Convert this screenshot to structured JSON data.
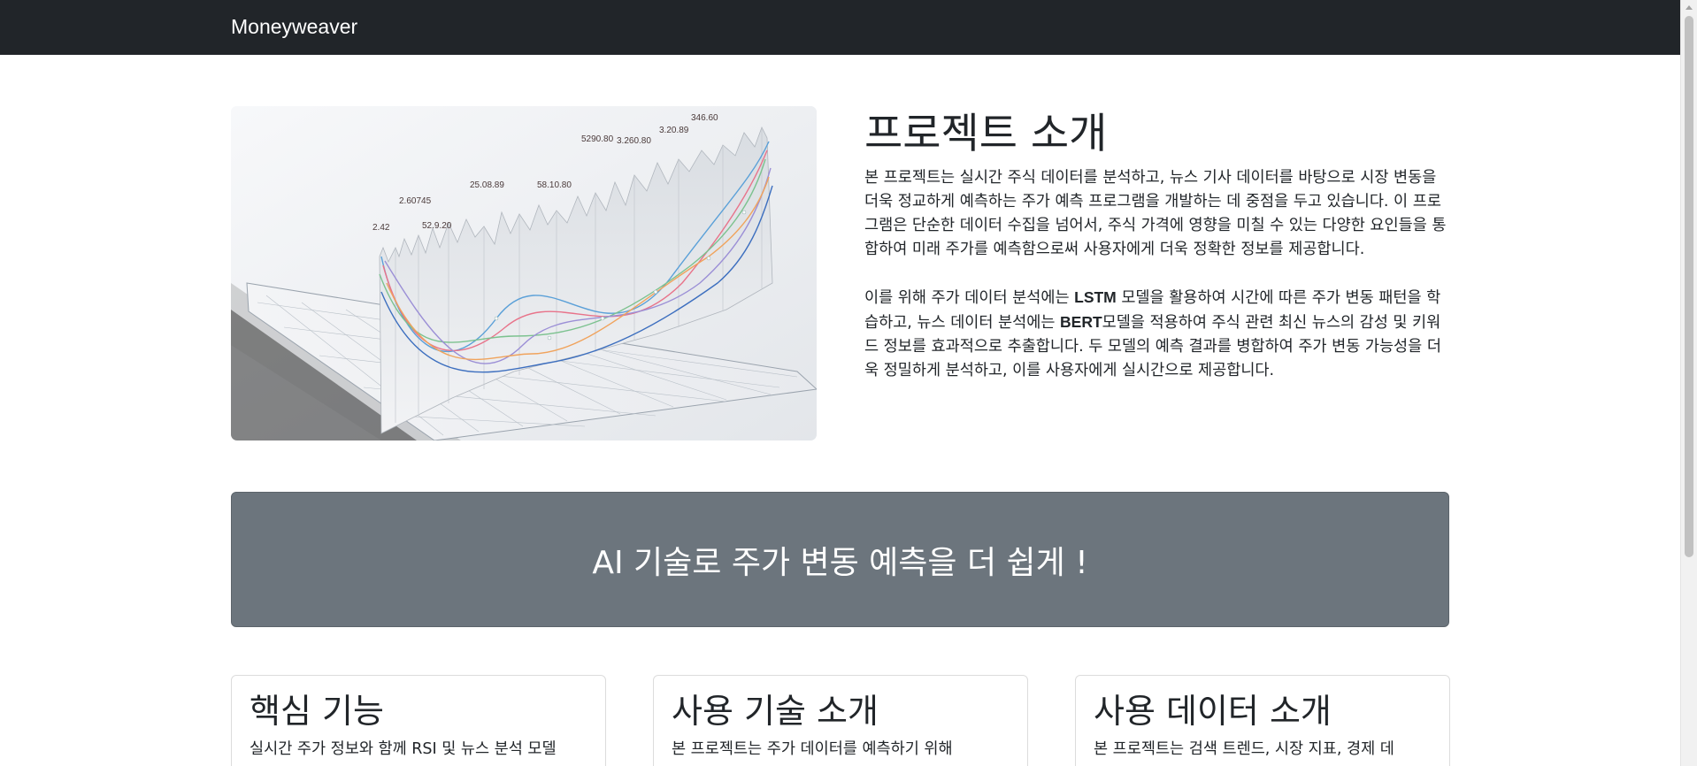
{
  "navbar": {
    "brand": "Moneyweaver"
  },
  "hero_image": {
    "label_2_42": "2.42",
    "label_2_60745": "2.60745",
    "label_52_9_20": "52.9.20",
    "label_25_08_89": "25.08.89",
    "label_58_10_80": "58.10.80",
    "label_5290_80": "5290.80",
    "label_3260_80": "3.260.80",
    "label_3_20_89": "3.20.89",
    "label_3460": "346.60"
  },
  "intro": {
    "title": "프로젝트 소개",
    "p1": "본 프로젝트는 실시간 주식 데이터를 분석하고, 뉴스 기사 데이터를 바탕으로 시장 변동을 더욱 정교하게 예측하는 주가 예측 프로그램을 개발하는 데 중점을 두고 있습니다. 이 프로그램은 단순한 데이터 수집을 넘어서, 주식 가격에 영향을 미칠 수 있는 다양한 요인들을 통합하여 미래 주가를 예측함으로써 사용자에게 더욱 정확한 정보를 제공합니다.",
    "p2_a": "이를 위해 주가 데이터 분석에는 ",
    "p2_lstm": "LSTM",
    "p2_b": " 모델을 활용하여 시간에 따른 주가 변동 패턴을 학습하고, 뉴스 데이터 분석에는 ",
    "p2_bert": "BERT",
    "p2_c": "모델을 적용하여 주식 관련 최신 뉴스의 감성 및 키워드 정보를 효과적으로 추출합니다. 두 모델의 예측 결과를 병합하여 주가 변동 가능성을 더욱 정밀하게 분석하고, 이를 사용자에게 실시간으로 제공합니다."
  },
  "banner": {
    "text": "AI 기술로 주가 변동 예측을 더 쉽게 !"
  },
  "cards": [
    {
      "title": "핵심 기능",
      "text": "실시간 주가 정보와 함께 RSI 및 뉴스 분석 모델"
    },
    {
      "title": "사용 기술 소개",
      "text": "본 프로젝트는 주가 데이터를 예측하기 위해"
    },
    {
      "title": "사용 데이터 소개",
      "text": "본 프로젝트는 검색 트렌드, 시장 지표, 경제 데"
    }
  ]
}
